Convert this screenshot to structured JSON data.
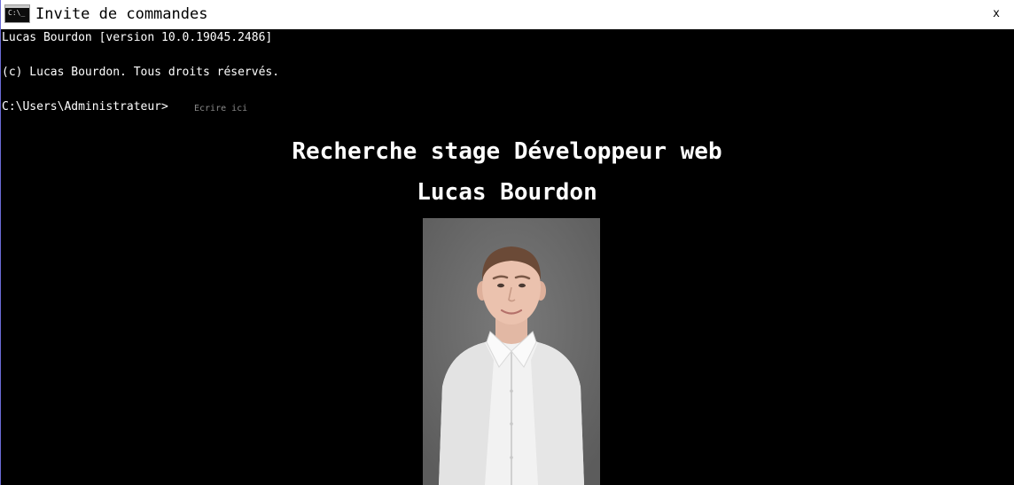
{
  "window": {
    "title": "Invite de commandes",
    "icon": "console-icon",
    "icon_text": "C:\\_",
    "close_label": "x"
  },
  "console": {
    "lines": [
      "Lucas Bourdon [version 10.0.19045.2486]",
      "(c) Lucas Bourdon. Tous droits réservés."
    ],
    "prompt": "C:\\Users\\Administrateur>",
    "input": {
      "value": "",
      "placeholder": "Ecrire ici"
    }
  },
  "main": {
    "title": "Recherche stage Développeur web",
    "name": "Lucas Bourdon"
  },
  "colors": {
    "background": "#000000",
    "text": "#ffffff",
    "titlebar": "#ffffff",
    "photo_backdrop": "#707070",
    "shirt": "#f2f2f2"
  }
}
